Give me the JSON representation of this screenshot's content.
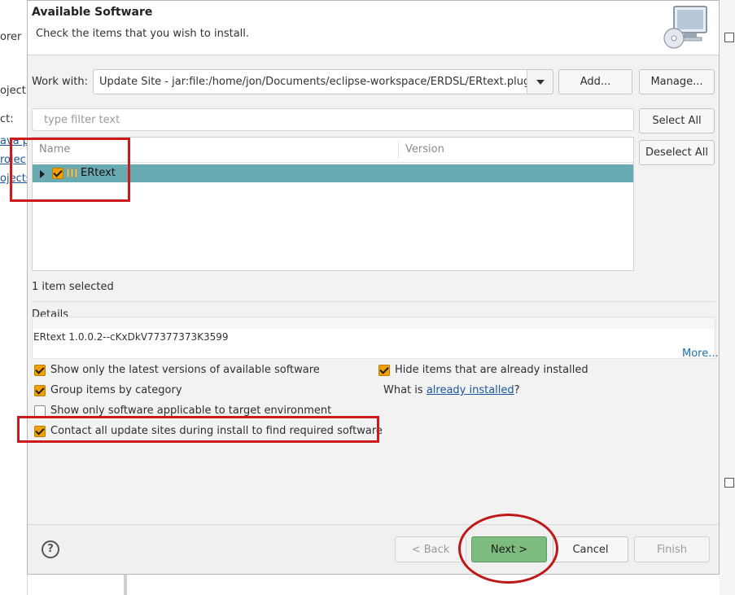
{
  "background": {
    "left_texts": [
      "orer",
      "oject",
      "ct:",
      "ava pr",
      "rojec",
      "ojects"
    ]
  },
  "dialog": {
    "title": "Available Software",
    "subtitle": "Check the items that you wish to install.",
    "work_with": {
      "label": "Work with:",
      "value": "Update Site - jar:file:/home/jon/Documents/eclipse-workspace/ERDSL/ERtext.plugin",
      "add_label": "Add...",
      "manage_label": "Manage..."
    },
    "filter": {
      "placeholder": "type filter text"
    },
    "select_all_label": "Select All",
    "deselect_all_label": "Deselect All",
    "tree": {
      "columns": {
        "name": "Name",
        "version": "Version"
      },
      "rows": [
        {
          "label": "ERtext",
          "checked": true,
          "selected": true
        }
      ]
    },
    "status": "1 item selected",
    "details": {
      "label": "Details",
      "text": "ERtext 1.0.0.2--cKxDkV77377373K3599",
      "more_link": "More..."
    },
    "options": {
      "latest_versions": {
        "label": "Show only the latest versions of available software",
        "checked": true
      },
      "group_by_category": {
        "label": "Group items by category",
        "checked": true
      },
      "target_env": {
        "label": "Show only software applicable to target environment",
        "checked": false
      },
      "contact_sites": {
        "label": "Contact all update sites during install to find required software",
        "checked": true
      },
      "hide_installed": {
        "label": "Hide items that are already installed",
        "checked": true
      },
      "what_is_prefix": "What is ",
      "what_is_link": "already installed",
      "what_is_suffix": "?"
    },
    "footer": {
      "help_glyph": "?",
      "back_label": "< Back",
      "next_label": "Next >",
      "cancel_label": "Cancel",
      "finish_label": "Finish"
    }
  },
  "colors": {
    "selection_row": "#6aaab2",
    "checkbox_checked": "#f0a000",
    "next_button": "#7dbb7e",
    "annotation_red": "#cc1a1a"
  }
}
